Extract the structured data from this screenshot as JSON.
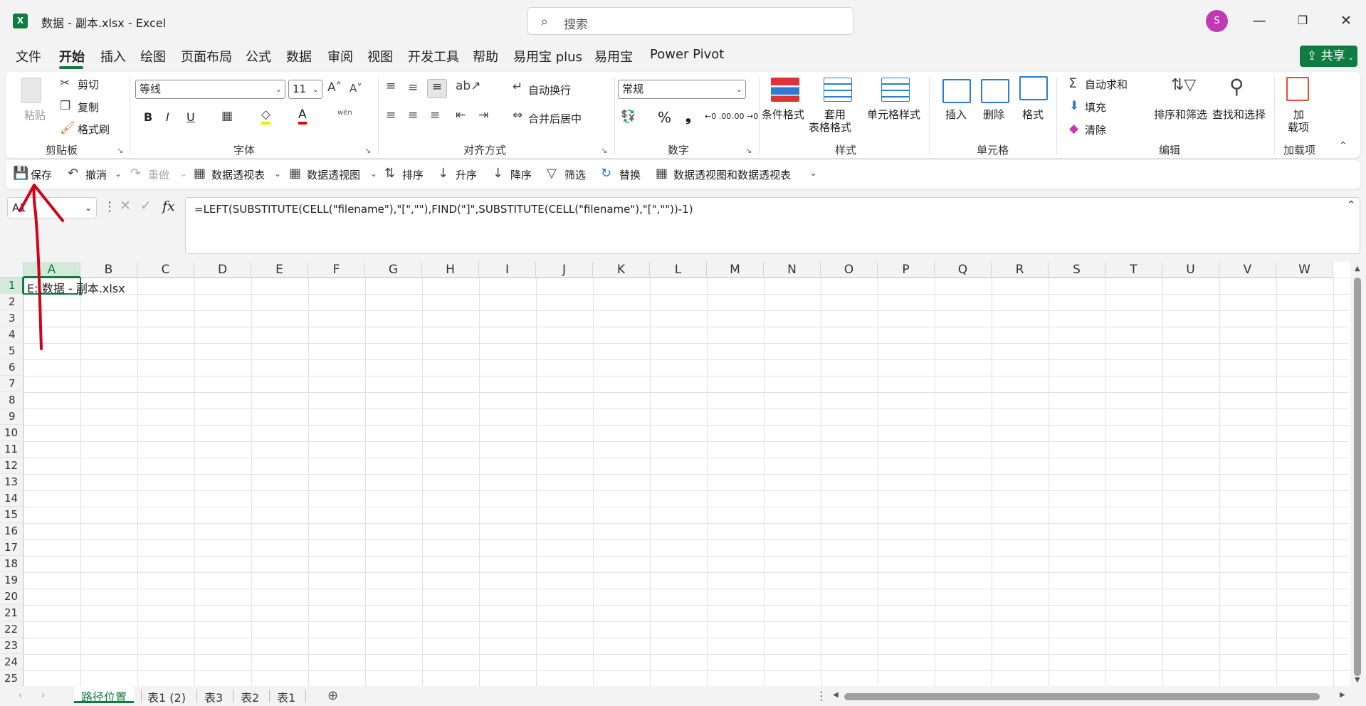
{
  "title_bar": {
    "app_icon_letter": "X",
    "document_title": "数据 - 副本.xlsx  -  Excel",
    "search_placeholder": "搜索",
    "avatar_initial": "S",
    "minimize_glyph": "—",
    "restore_glyph": "❐",
    "close_glyph": "✕"
  },
  "menu_tabs": [
    "文件",
    "开始",
    "插入",
    "绘图",
    "页面布局",
    "公式",
    "数据",
    "审阅",
    "视图",
    "开发工具",
    "帮助",
    "易用宝 plus",
    "易用宝",
    "Power Pivot"
  ],
  "active_tab": "开始",
  "share_label": "共享",
  "ribbon": {
    "clipboard": {
      "paste": "粘贴",
      "cut": "剪切",
      "copy": "复制",
      "format_painter": "格式刷",
      "label": "剪贴板"
    },
    "font": {
      "font_name": "等线",
      "font_size": "11",
      "bold": "B",
      "italic": "I",
      "underline": "U",
      "label": "字体",
      "phonetic": "wén"
    },
    "alignment": {
      "wrap_text": "自动换行",
      "merge_center": "合并后居中",
      "label": "对齐方式"
    },
    "number": {
      "format": "常规",
      "percent": "%",
      "comma": "❟",
      "inc_decimal": "←0 .00",
      "dec_decimal": ".00 →0",
      "label": "数字"
    },
    "styles": {
      "conditional": "条件格式",
      "table_style_line1": "套用",
      "table_style_line2": "表格格式",
      "cell_style": "单元格样式",
      "label": "样式"
    },
    "cells": {
      "insert": "插入",
      "delete": "删除",
      "format": "格式",
      "label": "单元格"
    },
    "editing": {
      "autosum": "自动求和",
      "fill": "填充",
      "clear": "清除",
      "sort_filter": "排序和筛选",
      "find_select": "查找和选择",
      "label": "编辑"
    },
    "addins": {
      "line1": "加",
      "line2": "载项",
      "label": "加载项"
    }
  },
  "quick_access": [
    {
      "label": "保存",
      "icon": "save-icon"
    },
    {
      "label": "撤消",
      "icon": "undo-icon"
    },
    {
      "label": "重做",
      "icon": "redo-icon"
    },
    {
      "label": "数据透视表",
      "icon": "pivot-table-icon"
    },
    {
      "label": "数据透视图",
      "icon": "pivot-chart-icon"
    },
    {
      "label": "排序",
      "icon": "sort-icon"
    },
    {
      "label": "升序",
      "icon": "sort-asc-icon"
    },
    {
      "label": "降序",
      "icon": "sort-desc-icon"
    },
    {
      "label": "筛选",
      "icon": "filter-icon"
    },
    {
      "label": "替换",
      "icon": "replace-icon"
    },
    {
      "label": "数据透视图和数据透视表",
      "icon": "pivot-combo-icon"
    }
  ],
  "formula_bar": {
    "name_box": "A1",
    "fx_label": "fx",
    "formula": "=LEFT(SUBSTITUTE(CELL(\"filename\"),\"[\",\"\"),FIND(\"]\",SUBSTITUTE(CELL(\"filename\"),\"[\",\"\"))-1)"
  },
  "grid": {
    "columns": [
      "A",
      "B",
      "C",
      "D",
      "E",
      "F",
      "G",
      "H",
      "I",
      "J",
      "K",
      "L",
      "M",
      "N",
      "O",
      "P",
      "Q",
      "R",
      "S",
      "T",
      "U",
      "V",
      "W"
    ],
    "rows": [
      "1",
      "2",
      "3",
      "4",
      "5",
      "6",
      "7",
      "8",
      "9",
      "10",
      "11",
      "12",
      "13",
      "14",
      "15",
      "16",
      "17",
      "18",
      "19",
      "20",
      "21",
      "22",
      "23",
      "24",
      "25"
    ],
    "selected_cell": "A1",
    "cell_A1": "E:\\数据 - 副本.xlsx"
  },
  "sheet_tabs": [
    "路径位置",
    "表1 (2)",
    "表3",
    "表2",
    "表1"
  ],
  "active_sheet": "路径位置",
  "colors": {
    "accent": "#107c41",
    "annotation": "#d0021b",
    "avatar": "#c239b3"
  }
}
